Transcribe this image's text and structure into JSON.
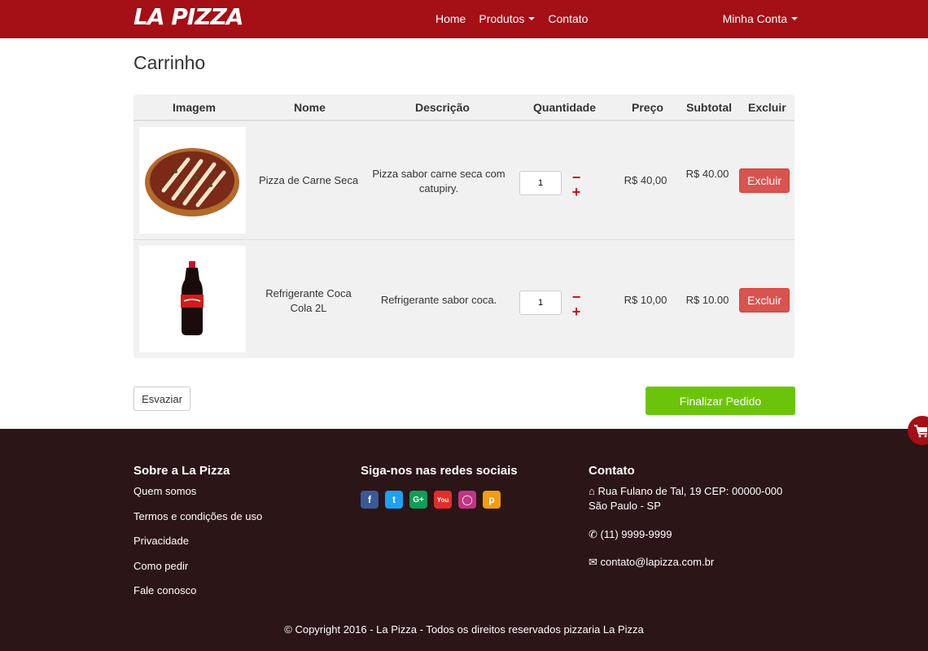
{
  "navbar": {
    "brand": "LA PIZZA",
    "links": [
      "Home",
      "Produtos",
      "Contato"
    ],
    "account": "Minha Conta"
  },
  "page": {
    "title": "Carrinho"
  },
  "cart": {
    "headers": [
      "Imagem",
      "Nome",
      "Descrição",
      "Quantidade",
      "Preço",
      "Subtotal",
      "Excluir"
    ],
    "items": [
      {
        "image": "pizza-image",
        "name": "Pizza de Carne Seca",
        "description": "Pizza sabor carne seca com catupiry.",
        "quantity": "1",
        "price": "R$ 40,00",
        "subtotal": "R$ 40.00",
        "delete_label": "Excluir"
      },
      {
        "image": "cola-bottle-image",
        "name": "Refrigerante Coca Cola 2L",
        "description": "Refrigerante sabor coca.",
        "quantity": "1",
        "price": "R$ 10,00",
        "subtotal": "R$ 10.00",
        "delete_label": "Excluir"
      }
    ]
  },
  "actions": {
    "empty": "Esvaziar",
    "checkout": "Finalizar Pedido"
  },
  "footer": {
    "about": {
      "title": "Sobre a La Pizza",
      "links": [
        "Quem somos",
        "Termos e condições de uso",
        "Privacidade",
        "Como pedir",
        "Fale conosco"
      ]
    },
    "social": {
      "title": "Siga-nos nas redes sociais",
      "icons": [
        "facebook-icon",
        "twitter-icon",
        "google-plus-icon",
        "youtube-icon",
        "instagram-icon",
        "pinterest-icon"
      ]
    },
    "contact": {
      "title": "Contato",
      "address": "Rua Fulano de Tal, 19 CEP: 00000-000 São Paulo - SP",
      "phone": "(11) 9999-9999",
      "email": "contato@lapizza.com.br"
    },
    "copyright": "© Copyright 2016 - La Pizza - Todos os direitos reservados pizzaria La Pizza"
  },
  "colors": {
    "brand_red": "#a50f16",
    "footer_bg": "#2b1517",
    "checkout_green": "#6cc40a",
    "delete_red": "#d9534f"
  }
}
